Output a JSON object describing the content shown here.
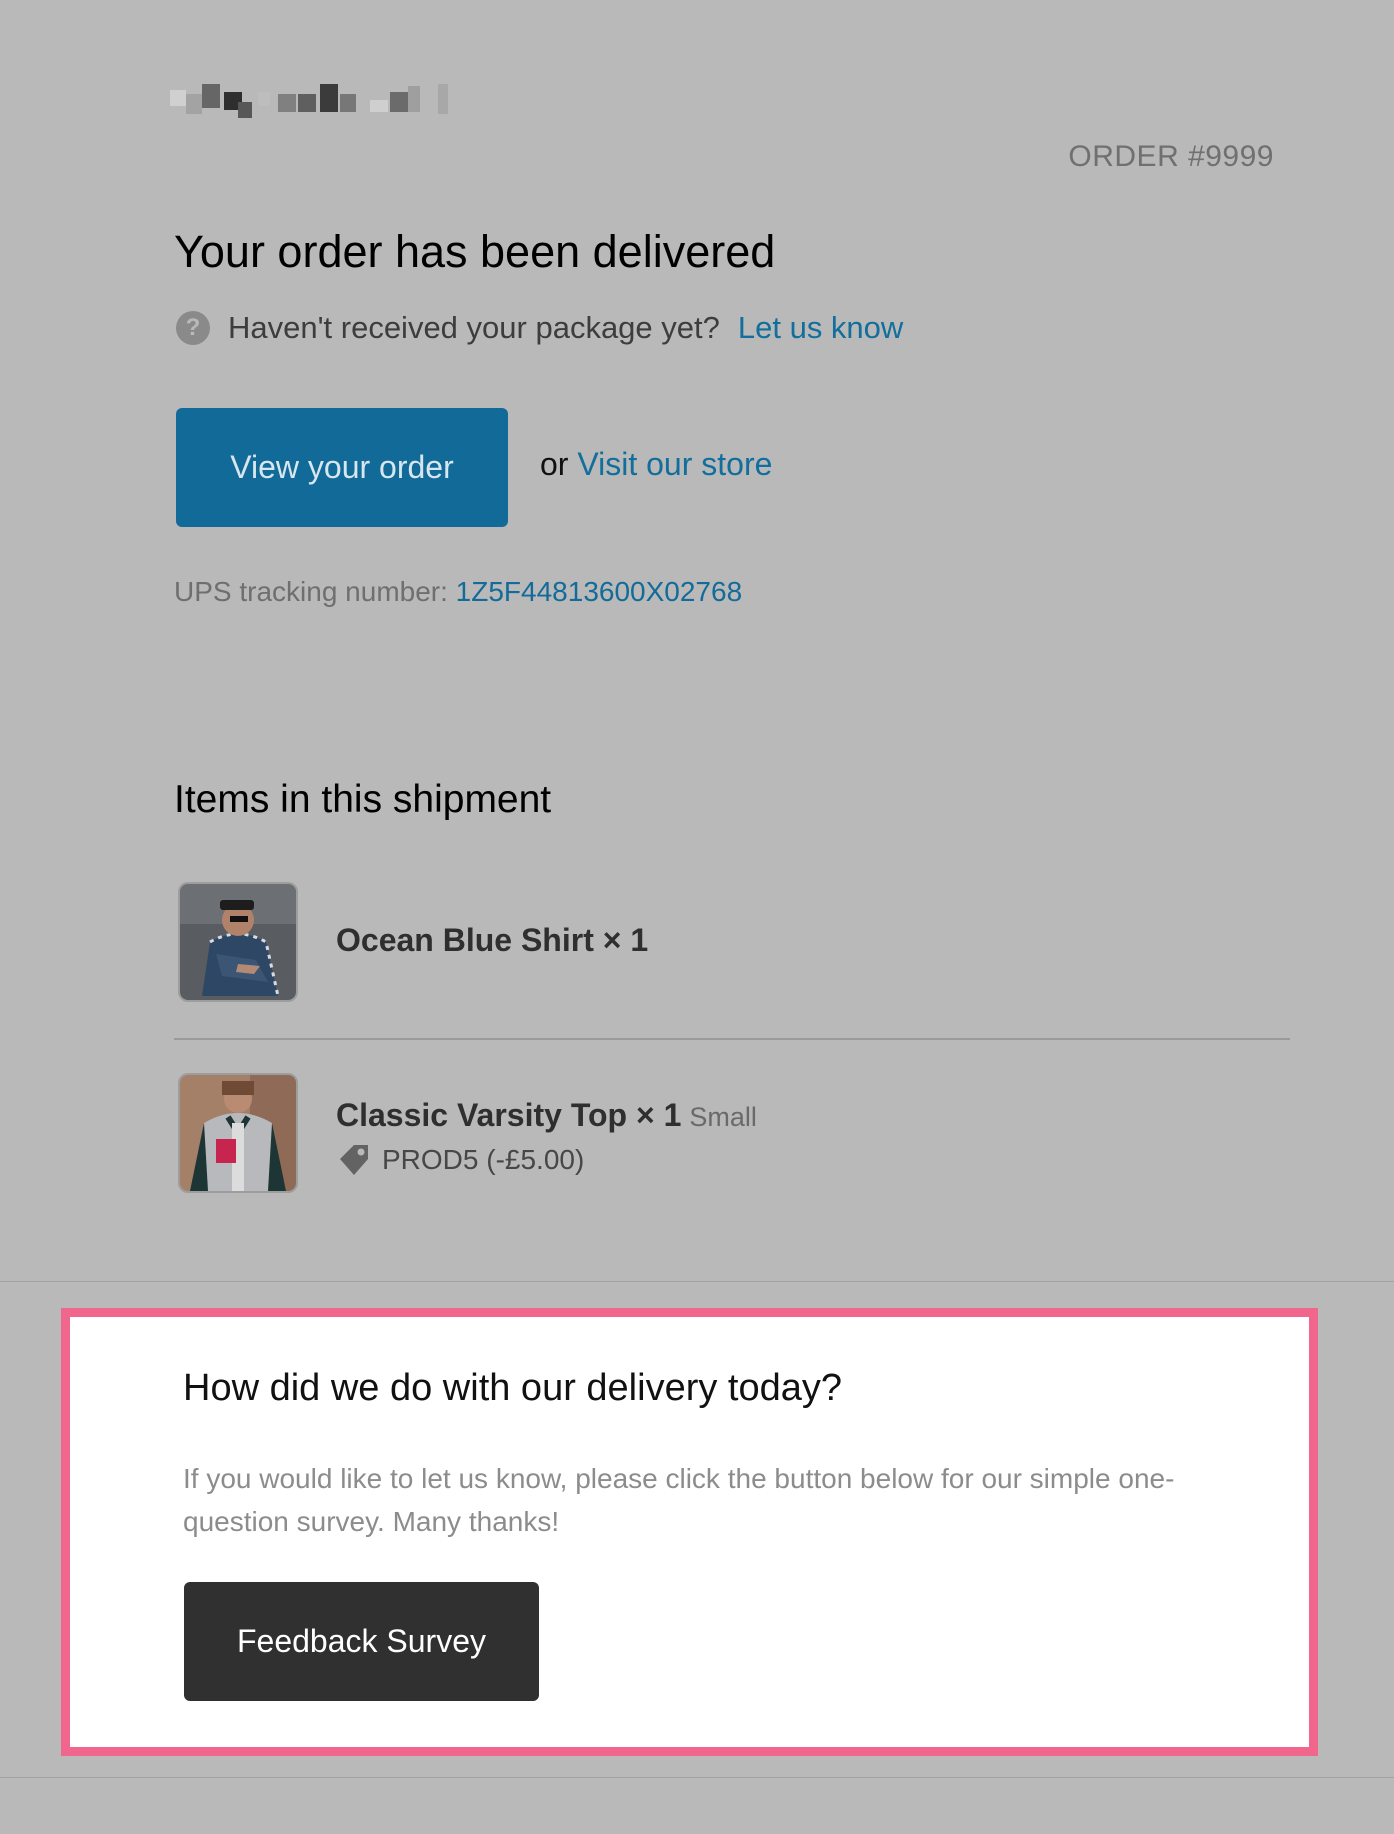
{
  "email": {
    "logo_alt": "",
    "order_number": "ORDER #9999",
    "headline": "Your order has been delivered",
    "help": {
      "question": "Haven't received your package yet?",
      "link": "Let us know"
    },
    "actions": {
      "view_order_button": "View your order",
      "or_text": "or",
      "visit_store_link": "Visit our store"
    },
    "tracking": {
      "label": "UPS tracking number:",
      "number": "1Z5F44813600X02768"
    },
    "items_heading": "Items in this shipment",
    "items": [
      {
        "name": "Ocean Blue Shirt × 1",
        "image_icon": "shirt-product-photo"
      },
      {
        "name": "Classic Varsity Top × 1",
        "variant": "Small",
        "discount": "PROD5 (-£5.00)",
        "image_icon": "varsity-top-product-photo",
        "discount_icon": "tag-icon"
      }
    ],
    "survey": {
      "title": "How did we do with our delivery today?",
      "text": "If you would like to let us know, please click the button below for our simple one-question survey. Many thanks!",
      "button": "Feedback Survey",
      "highlight_color": "#f0668d"
    }
  }
}
